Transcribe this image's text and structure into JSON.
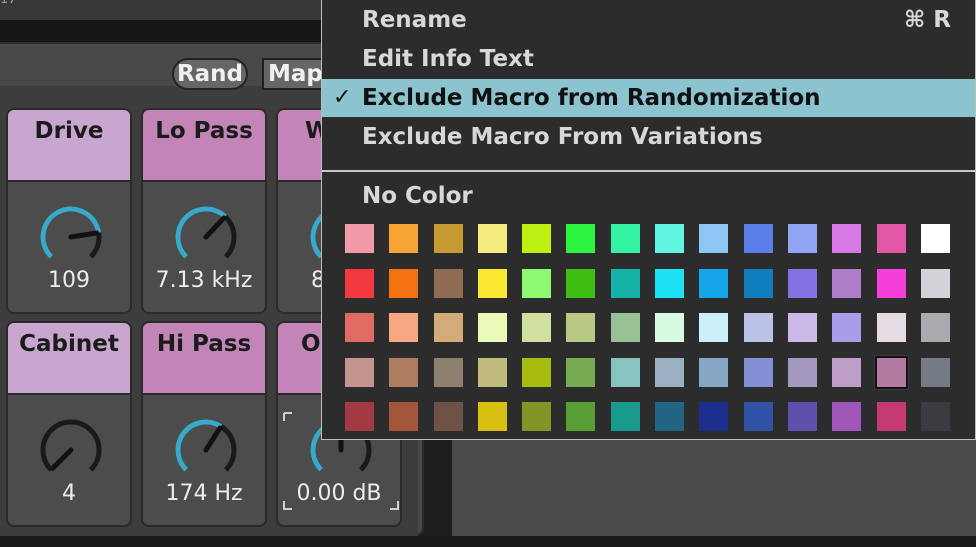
{
  "top": {
    "partial_text": "17"
  },
  "rack": {
    "rand_label": "Rand",
    "map_label": "Map",
    "macros": [
      {
        "name": "Drive",
        "value": "109",
        "color": "#c9a6cf",
        "level": 0.8,
        "accent": "#3aa8c8"
      },
      {
        "name": "Lo Pass",
        "value": "7.13 kHz",
        "color": "#c385b7",
        "level": 0.66,
        "accent": "#3aa8c8"
      },
      {
        "name": "W",
        "value": "8",
        "color": "#c385b7",
        "level": 0.5,
        "accent": "#3aa8c8"
      },
      {
        "name": "Cabinet",
        "value": "4",
        "color": "#c9a6cf",
        "level": 0.0,
        "accent": "#3aa8c8"
      },
      {
        "name": "Hi Pass",
        "value": "174 Hz",
        "color": "#c385b7",
        "level": 0.62,
        "accent": "#3aa8c8"
      },
      {
        "name": "O",
        "value": "0.00 dB",
        "color": "#c385b7",
        "level": 0.5,
        "accent": "#3aa8c8"
      }
    ]
  },
  "menu": {
    "items": [
      {
        "label": "Rename",
        "shortcut": "⌘ R"
      },
      {
        "label": "Edit Info Text"
      },
      {
        "label": "Exclude Macro from Randomization",
        "checked": true,
        "check_glyph": "✓"
      },
      {
        "label": "Exclude Macro From Variations"
      }
    ],
    "no_color_label": "No Color",
    "selected_swatch_index": 54,
    "swatches": [
      "#f39aa9",
      "#f6a534",
      "#c79a32",
      "#f3eb7e",
      "#bef012",
      "#2cf542",
      "#33f2a3",
      "#60f5e1",
      "#8cc6f5",
      "#5b7ee8",
      "#92a5f5",
      "#d77ae7",
      "#e358a6",
      "#ffffff",
      "#f2393f",
      "#f37110",
      "#8f6c52",
      "#fbe934",
      "#8dfa72",
      "#3fbf13",
      "#15b3a7",
      "#1de1f4",
      "#14a5ea",
      "#0f7ebf",
      "#8471e3",
      "#b07dcb",
      "#f43fdd",
      "#d2d3d6",
      "#df6b63",
      "#f6a680",
      "#d2ab79",
      "#eafab9",
      "#d2e09f",
      "#b8c985",
      "#99c196",
      "#d8f9e2",
      "#ccf0f9",
      "#bbc3e7",
      "#cab9e7",
      "#ab9ce9",
      "#e6dde4",
      "#a9abaf",
      "#c4958f",
      "#ae7c5e",
      "#8f7f6e",
      "#c0bc7b",
      "#a8bb11",
      "#78ac54",
      "#89c3be",
      "#9ab1c2",
      "#86a6c6",
      "#838fd4",
      "#a399bf",
      "#bd9ec8",
      "#b27aa0",
      "#747b85",
      "#a33a41",
      "#a35639",
      "#6e5248",
      "#d8c013",
      "#849528",
      "#569e35",
      "#189a8d",
      "#226484",
      "#1c2f8f",
      "#2f52a4",
      "#6150ab",
      "#a055b9",
      "#c63a74",
      "#3a3c3f"
    ]
  }
}
